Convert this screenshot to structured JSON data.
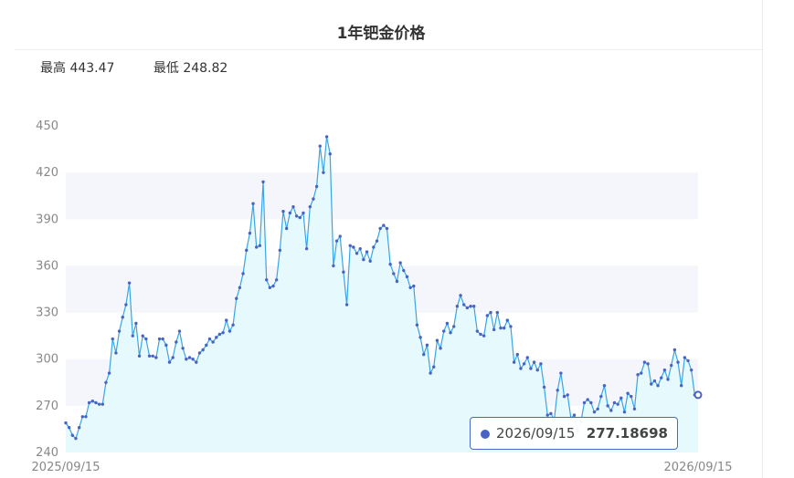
{
  "title": "1年钯金价格",
  "stats": {
    "high_label": "最高 443.47",
    "low_label": "最低 248.82"
  },
  "tooltip": {
    "date": "2026/09/15",
    "value": "277.18698"
  },
  "colors": {
    "line": "#3aa5e6",
    "marker": "#4a63c2",
    "area": "#e6f9fc",
    "band": "#f5f6fb"
  },
  "chart_data": {
    "type": "line",
    "title": "1年钯金价格",
    "xlabel": "",
    "ylabel": "",
    "ylim": [
      240,
      450
    ],
    "yticks": [
      240,
      270,
      300,
      330,
      360,
      390,
      420,
      450
    ],
    "xtick_labels": [
      "2025/09/15",
      "2026/09/15"
    ],
    "grid": "horizontal-bands",
    "area_fill": true,
    "series": [
      {
        "values": [
          259,
          256,
          251,
          249,
          256,
          263,
          263,
          272,
          273,
          272,
          271,
          271,
          285,
          291,
          313,
          304,
          318,
          327,
          335,
          349,
          315,
          323,
          302,
          315,
          313,
          302,
          302,
          301,
          313,
          313,
          309,
          298,
          301,
          311,
          318,
          307,
          300,
          301,
          300,
          298,
          304,
          306,
          309,
          313,
          311,
          314,
          316,
          317,
          325,
          318,
          322,
          339,
          346,
          355,
          370,
          381,
          400,
          372,
          373,
          414,
          351,
          346,
          347,
          351,
          370,
          395,
          384,
          394,
          398,
          392,
          391,
          394,
          371,
          398,
          403,
          411,
          437,
          420,
          443,
          432,
          360,
          376,
          379,
          356,
          335,
          373,
          372,
          368,
          371,
          364,
          369,
          363,
          372,
          376,
          384,
          386,
          384,
          361,
          355,
          350,
          362,
          357,
          353,
          346,
          347,
          322,
          314,
          303,
          309,
          291,
          295,
          312,
          307,
          318,
          323,
          317,
          321,
          334,
          341,
          335,
          333,
          334,
          334,
          318,
          316,
          315,
          328,
          330,
          319,
          330,
          320,
          320,
          325,
          321,
          298,
          303,
          294,
          297,
          301,
          294,
          298,
          293,
          297,
          282,
          264,
          265,
          261,
          280,
          291,
          276,
          277,
          262,
          264,
          254,
          260,
          272,
          274,
          272,
          266,
          268,
          276,
          283,
          270,
          267,
          272,
          271,
          275,
          266,
          278,
          276,
          268,
          290,
          291,
          298,
          297,
          284,
          286,
          283,
          288,
          293,
          287,
          296,
          306,
          298,
          283,
          301,
          299,
          293,
          277,
          277
        ]
      }
    ]
  }
}
